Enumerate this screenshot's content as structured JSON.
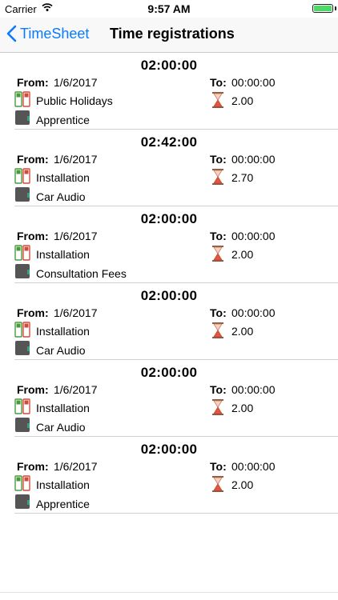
{
  "status": {
    "carrier": "Carrier",
    "time": "9:57 AM"
  },
  "nav": {
    "back_label": "TimeSheet",
    "title": "Time registrations"
  },
  "labels": {
    "from": "From:",
    "to": "To:"
  },
  "colors": {
    "accent": "#0a7aff",
    "battery": "#4cd964"
  },
  "entries": [
    {
      "duration": "02:00:00",
      "from": "1/6/2017",
      "to": "00:00:00",
      "type": "Public Holidays",
      "hours": "2.00",
      "category": "Apprentice"
    },
    {
      "duration": "02:42:00",
      "from": "1/6/2017",
      "to": "00:00:00",
      "type": "Installation",
      "hours": "2.70",
      "category": "Car Audio"
    },
    {
      "duration": "02:00:00",
      "from": "1/6/2017",
      "to": "00:00:00",
      "type": "Installation",
      "hours": "2.00",
      "category": "Consultation Fees"
    },
    {
      "duration": "02:00:00",
      "from": "1/6/2017",
      "to": "00:00:00",
      "type": "Installation",
      "hours": "2.00",
      "category": "Car Audio"
    },
    {
      "duration": "02:00:00",
      "from": "1/6/2017",
      "to": "00:00:00",
      "type": "Installation",
      "hours": "2.00",
      "category": "Car Audio"
    },
    {
      "duration": "02:00:00",
      "from": "1/6/2017",
      "to": "00:00:00",
      "type": "Installation",
      "hours": "2.00",
      "category": "Apprentice"
    }
  ]
}
